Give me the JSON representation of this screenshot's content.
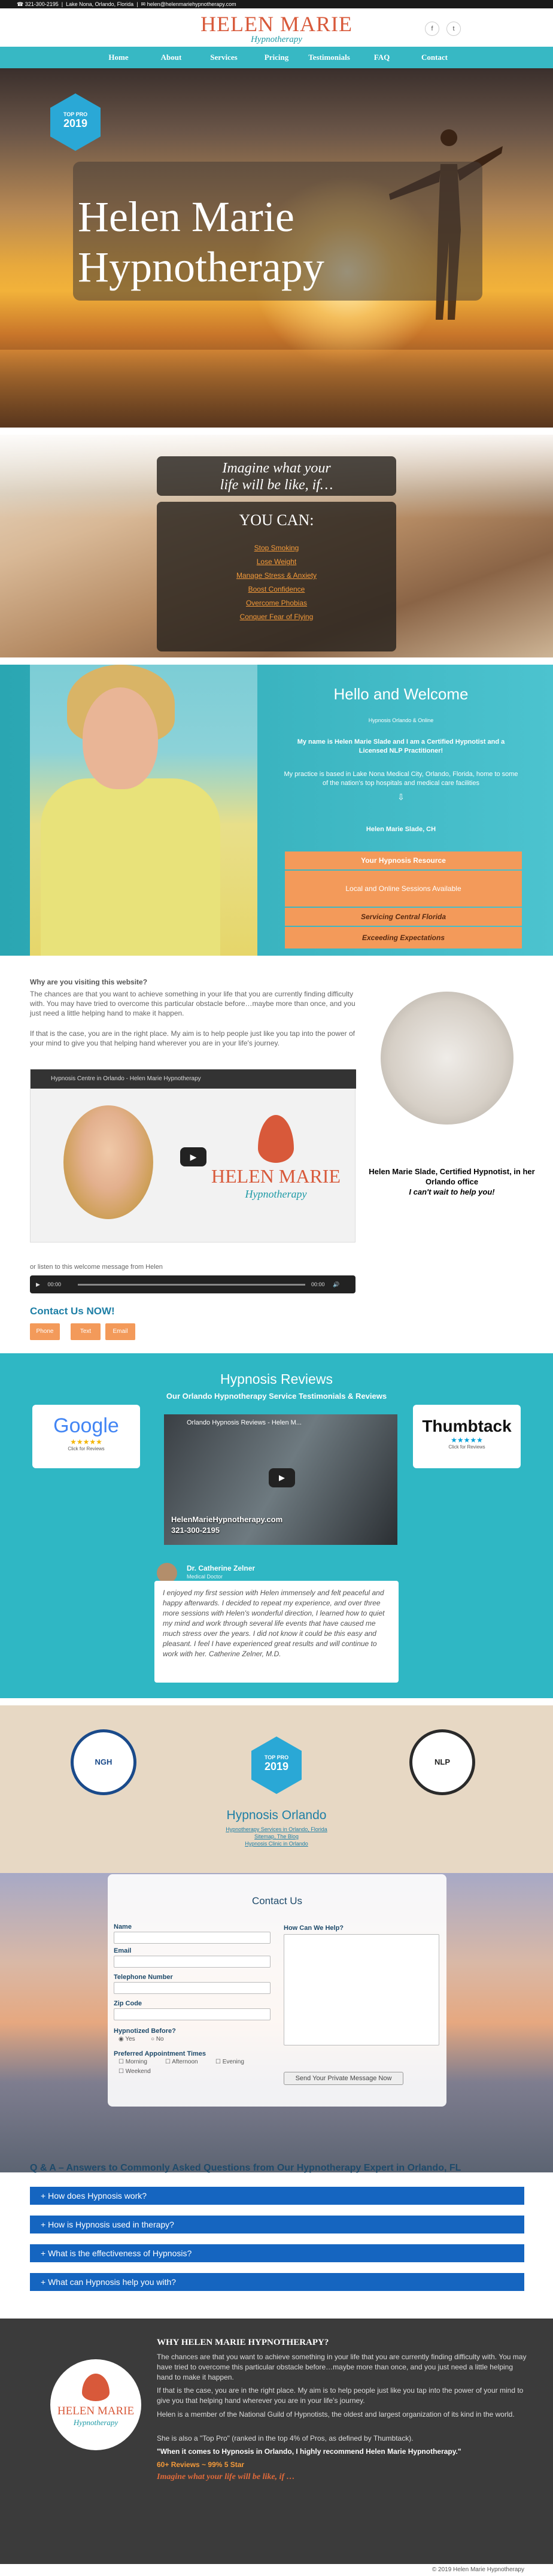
{
  "topbar": {
    "phone": "321-300-2195",
    "location": "Lake Nona, Orlando, Florida",
    "email": "helen@helenmariehypnotherapy.com"
  },
  "header": {
    "logo_title": "HELEN MARIE",
    "logo_sub": "Hypnotherapy",
    "social": [
      "f",
      "t"
    ]
  },
  "nav": {
    "items": [
      "Home",
      "About",
      "Services",
      "Pricing",
      "Testimonials",
      "FAQ",
      "Contact"
    ]
  },
  "hero": {
    "badge_top": "TOP PRO",
    "badge_year": "2019",
    "title_line1": "Helen Marie",
    "title_line2": "Hypnotherapy"
  },
  "beach": {
    "imagine_line1": "Imagine what your",
    "imagine_line2": "life will be like, if…",
    "you_can": "YOU CAN:",
    "items": [
      "Stop Smoking",
      "Lose Weight",
      "Manage Stress & Anxiety",
      "Boost Confidence",
      "Overcome Phobias",
      "Conquer Fear of Flying"
    ]
  },
  "welcome": {
    "heading": "Hello and Welcome",
    "sub": "Hypnosis Orlando & Online",
    "intro": "My name is Helen Marie Slade and I am a Certified Hypnotist and a Licensed NLP Practitioner!",
    "practice": "My practice is based in Lake Nona Medical City, Orlando, Florida, home to some of the nation's top hospitals and medical care facilities",
    "signature": "Helen Marie Slade, CH",
    "bars": [
      "Your Hypnosis Resource",
      "Local and Online Sessions Available",
      "Servicing Central Florida",
      "Exceeding Expectations"
    ]
  },
  "why": {
    "heading": "Why are you visiting this website?",
    "p1": "The chances are that you want to achieve something in your life that you are currently finding difficulty with. You may have tried to overcome this particular obstacle before…maybe more than once, and you just need a little helping hand to make it happen.",
    "p2": "If that is the case, you are in the right place. My aim is to help people just like you tap into the power of your mind to give you that helping hand wherever you are in your life's journey.",
    "video_title": "Hypnosis Centre in Orlando - Helen Marie Hypnotherapy",
    "video_logo": "HELEN MARIE",
    "video_logo_sub": "Hypnotherapy",
    "listen": "or listen to this welcome message from Helen",
    "audio_start": "00:00",
    "audio_end": "00:00",
    "office_caption_1": "Helen Marie Slade, Certified Hypnotist, in her Orlando office",
    "office_caption_2": "I can't wait to help you!"
  },
  "contact_now": {
    "heading": "Contact Us NOW!",
    "buttons": [
      "Phone",
      "Text",
      "Email"
    ]
  },
  "reviews": {
    "heading": "Hypnosis Reviews",
    "sub": "Our Orlando Hypnotherapy Service Testimonials & Reviews",
    "google": "Google",
    "google_stars": "★★★★★",
    "google_click": "Click for Reviews",
    "thumbtack": "Thumbtack",
    "thumbtack_stars": "★★★★★",
    "thumbtack_click": "Click for Reviews",
    "video_title": "Orlando Hypnosis Reviews - Helen M...",
    "video_site": "HelenMarieHypnotherapy.com",
    "video_phone": "321-300-2195",
    "reviewer_name": "Dr. Catherine Zelner",
    "reviewer_role": "Medical Doctor",
    "quote": "I enjoyed my first session with Helen immensely and felt peaceful and happy afterwards. I decided to repeat my experience, and over three more sessions with Helen's wonderful direction, I learned how to quiet my mind and work through several life events that have caused me much stress over the years. I did not know it could be this easy and pleasant. I feel I have experienced great results and will continue to work with her. Catherine Zelner, M.D."
  },
  "orlando": {
    "heading": "Hypnosis Orlando",
    "badge_top": "TOP PRO",
    "badge_year": "2019",
    "seal_left": "NGH",
    "seal_right": "NLP",
    "links": [
      "Hypnotherapy Services in Orlando, Florida",
      "Sitemap, The Blog",
      "Hypnosis Clinic in Orlando"
    ]
  },
  "contact_form": {
    "heading": "Contact Us",
    "name": "Name",
    "email": "Email",
    "phone": "Telephone Number",
    "zip": "Zip Code",
    "hypnotized": "Hypnotized Before?",
    "yes": "Yes",
    "no": "No",
    "pref": "Preferred Appointment Times",
    "times": [
      "Morning",
      "Afternoon",
      "Evening",
      "Weekend"
    ],
    "help": "How Can We Help?",
    "send": "Send Your Private Message Now"
  },
  "faq": {
    "heading": "Q & A – Answers to Commonly Asked Questions from Our Hypnotherapy Expert in Orlando, FL",
    "items": [
      "How does Hypnosis work?",
      "How is Hypnosis used in therapy?",
      "What is the effectiveness of Hypnosis?",
      "What can Hypnosis help you with?"
    ]
  },
  "footer_why": {
    "heading": "WHY HELEN MARIE HYPNOTHERAPY?",
    "p1": "The chances are that you want to achieve something in your life that you are currently finding difficulty with. You may have tried to overcome this particular obstacle before…maybe more than once, and you just need a little helping hand to make it happen.",
    "p2": "If that is the case, you are in the right place. My aim is to help people just like you tap into the power of your mind to give you that helping hand wherever you are in your life's journey.",
    "p3": "Helen is a member of the National Guild of Hypnotists, the oldest and largest organization of its kind in the world.",
    "p4": "She is also a \"Top Pro\" (ranked in the top 4% of Pros, as defined by Thumbtack).",
    "quote": "\"When it comes to Hypnosis in Orlando, I highly recommend Helen Marie Hypnotherapy.\"",
    "rating": "60+ Reviews ~ 99% 5 Star",
    "imagine": "Imagine what your life will be like, if …",
    "logo_title": "HELEN MARIE",
    "logo_sub": "Hypnotherapy"
  },
  "copyright": "© 2019 Helen Marie Hypnotherapy",
  "colors": {
    "teal": "#37b8c4",
    "orange": "#f39a5a",
    "brand_red": "#d8593a",
    "faq_blue": "#1565c0"
  }
}
